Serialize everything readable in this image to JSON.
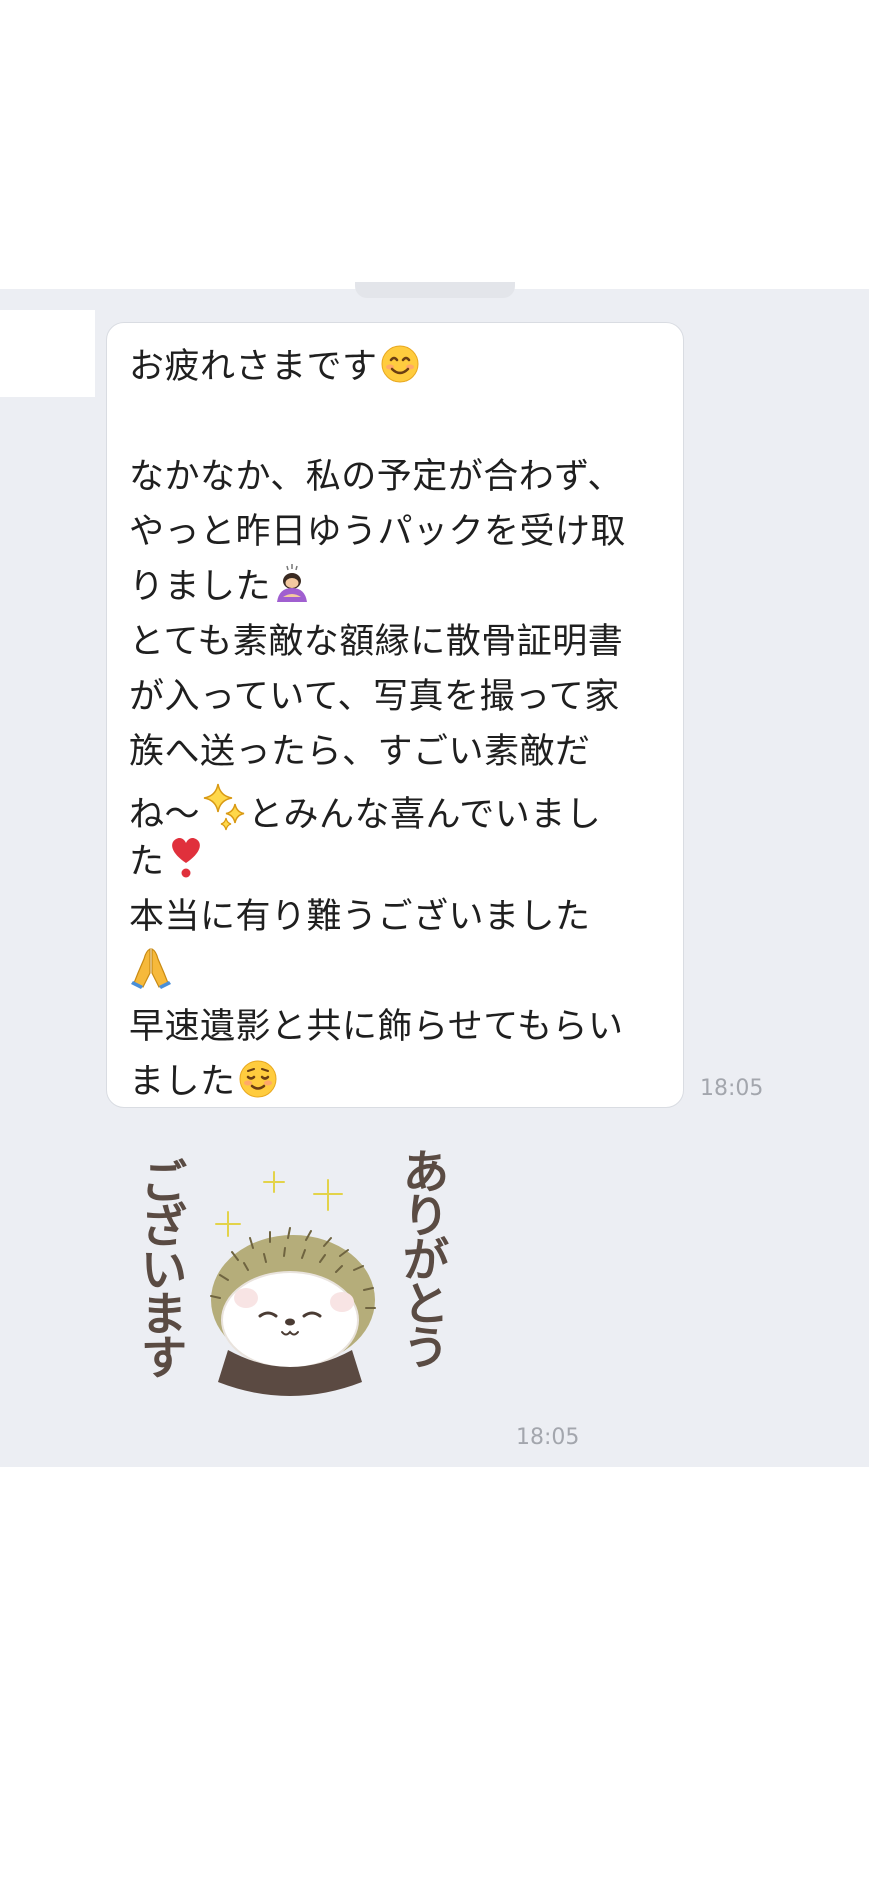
{
  "message": {
    "lines": [
      "お疲れさまです",
      "",
      "なかなか、私の予定が合わず、",
      "やっと昨日ゆうパックを受け取",
      "りました",
      "とても素敵な額縁に散骨証明書",
      "が入っていて、写真を撮って家",
      "族へ送ったら、すごい素敵だ",
      "ね〜",
      "とみんな喜んでいまし",
      "た",
      "本当に有り難うございました",
      "",
      "早速遺影と共に飾らせてもらい",
      "ました"
    ],
    "timestamp": "18:05",
    "emojis": {
      "smile": "smiling-face-emoji",
      "bow": "person-bowing-emoji",
      "sparkles": "sparkles-emoji",
      "heart": "heavy-heart-exclamation-emoji",
      "pray": "folded-hands-emoji",
      "relieved": "relieved-face-emoji"
    }
  },
  "sticker": {
    "text_left": "ございます",
    "text_right": "ありがとう",
    "timestamp": "18:05",
    "icon": "hedgehog-sticker"
  },
  "colors": {
    "chat_background": "#eceef3",
    "bubble_background": "#ffffff",
    "text": "#1f1f1f",
    "timestamp": "#a3a6ad",
    "sticker_text": "#5a4b43",
    "sparkle": "#f2e56b"
  }
}
